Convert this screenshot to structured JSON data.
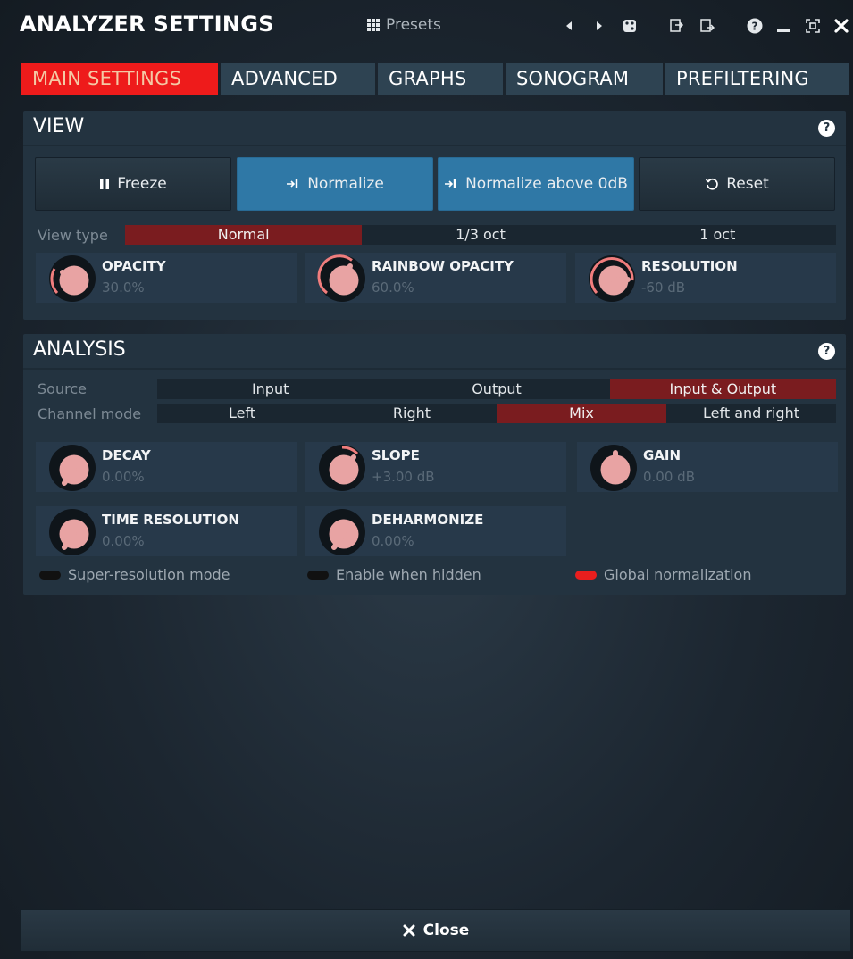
{
  "window": {
    "title": "ANALYZER SETTINGS",
    "presets_label": "Presets"
  },
  "tabs": [
    {
      "label": "MAIN SETTINGS",
      "active": true
    },
    {
      "label": "ADVANCED",
      "active": false
    },
    {
      "label": "GRAPHS",
      "active": false
    },
    {
      "label": "SONOGRAM",
      "active": false
    },
    {
      "label": "PREFILTERING",
      "active": false
    }
  ],
  "view": {
    "title": "VIEW",
    "buttons": {
      "freeze": "Freeze",
      "normalize": "Normalize",
      "normalize_above": "Normalize above 0dB",
      "reset": "Reset"
    },
    "view_type": {
      "label": "View type",
      "options": [
        "Normal",
        "1/3 oct",
        "1 oct"
      ],
      "selected": "Normal"
    },
    "knobs": [
      {
        "name": "OPACITY",
        "value": "30.0%"
      },
      {
        "name": "RAINBOW OPACITY",
        "value": "60.0%"
      },
      {
        "name": "RESOLUTION",
        "value": "-60 dB"
      }
    ]
  },
  "analysis": {
    "title": "ANALYSIS",
    "source": {
      "label": "Source",
      "options": [
        "Input",
        "Output",
        "Input & Output"
      ],
      "selected": "Input & Output"
    },
    "channel_mode": {
      "label": "Channel mode",
      "options": [
        "Left",
        "Right",
        "Mix",
        "Left and right"
      ],
      "selected": "Mix"
    },
    "knobs": [
      {
        "name": "DECAY",
        "value": "0.00%"
      },
      {
        "name": "SLOPE",
        "value": "+3.00 dB"
      },
      {
        "name": "GAIN",
        "value": "0.00 dB"
      },
      {
        "name": "TIME RESOLUTION",
        "value": "0.00%"
      },
      {
        "name": "DEHARMONIZE",
        "value": "0.00%"
      }
    ],
    "toggles": [
      {
        "label": "Super-resolution mode",
        "on": false
      },
      {
        "label": "Enable when hidden",
        "on": false
      },
      {
        "label": "Global normalization",
        "on": true
      }
    ]
  },
  "footer": {
    "close_label": "Close"
  },
  "colors": {
    "accent_red": "#ee1b1b",
    "selected_segment": "#7a1c1f",
    "active_button_blue": "#2f78a6",
    "knob_body": "#e8a3a3",
    "knob_arc": "#f07d7d",
    "panel_bg": "#233340"
  },
  "icons": {
    "presets": "grid-icon",
    "prev": "triangle-left-icon",
    "next": "triangle-right-icon",
    "random": "dice-icon",
    "copy": "copy-icon",
    "paste": "paste-icon",
    "help": "help-icon",
    "minimize": "minimize-icon",
    "screenshot": "capture-icon",
    "close": "close-icon"
  }
}
